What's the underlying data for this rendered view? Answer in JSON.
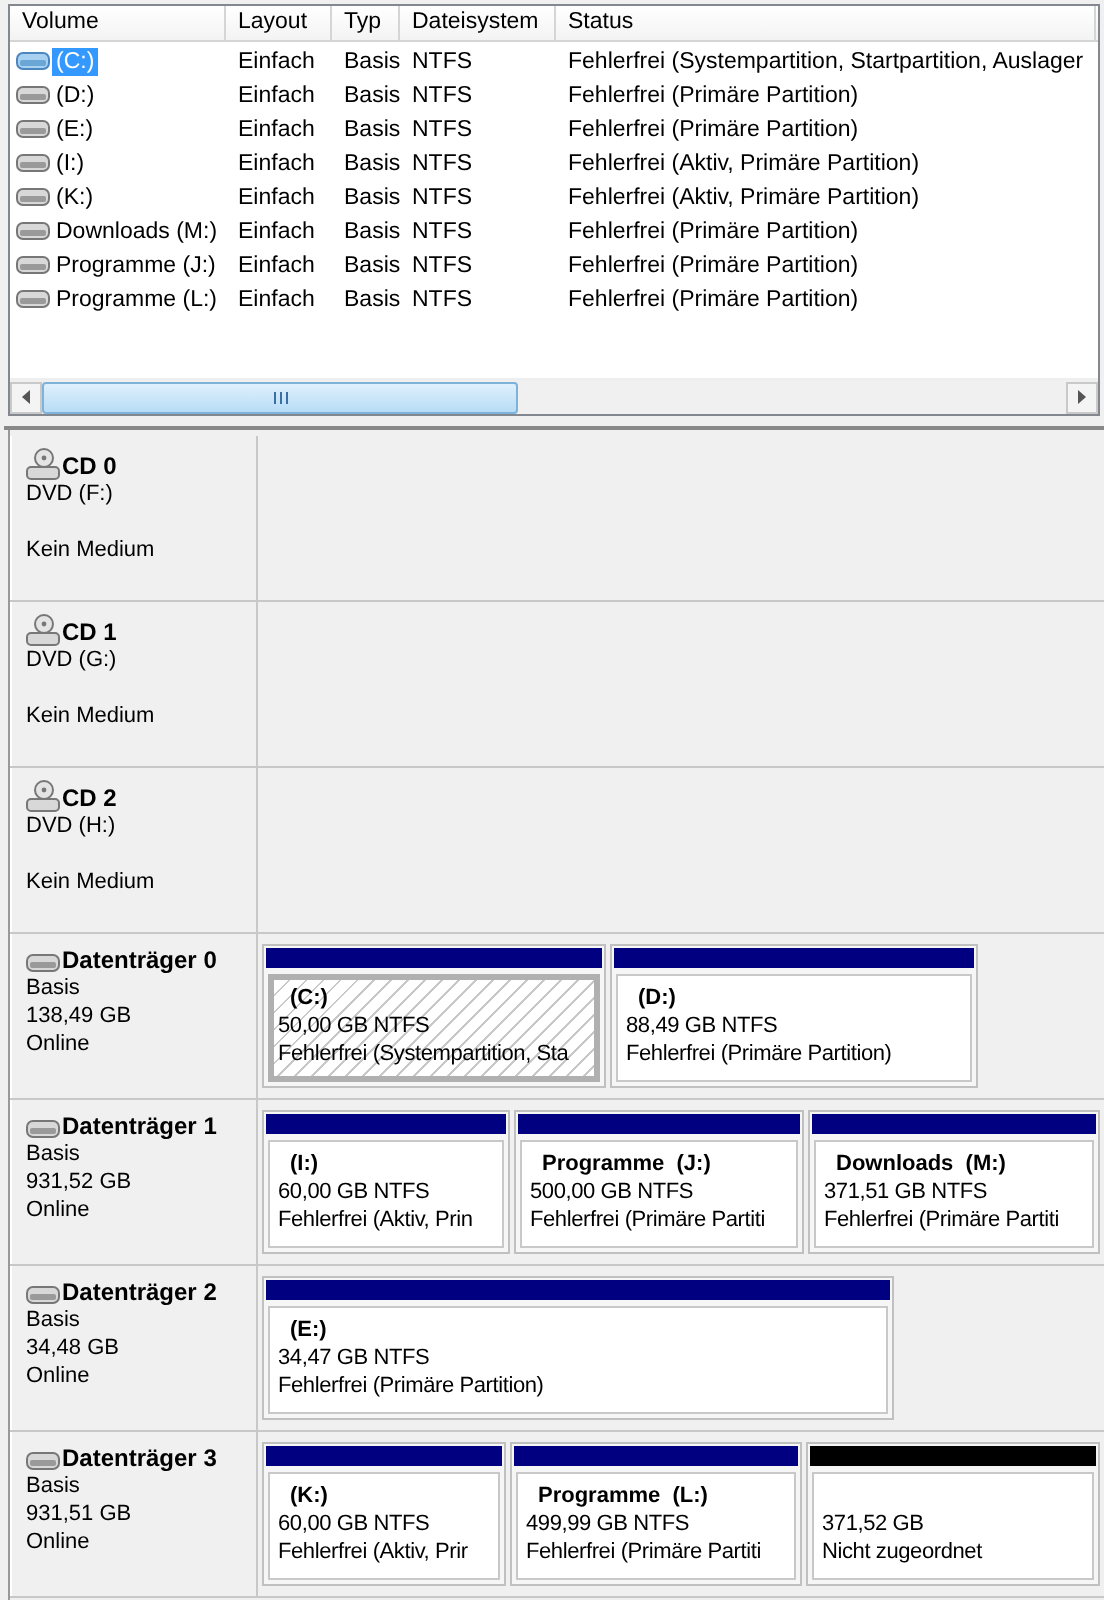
{
  "volume_list": {
    "columns": [
      "Volume",
      "Layout",
      "Typ",
      "Dateisystem",
      "Status"
    ],
    "rows": [
      {
        "volume": "(C:)",
        "layout": "Einfach",
        "type": "Basis",
        "filesystem": "NTFS",
        "status": "Fehlerfrei (Systempartition, Startpartition, Auslager",
        "selected": true
      },
      {
        "volume": "(D:)",
        "layout": "Einfach",
        "type": "Basis",
        "filesystem": "NTFS",
        "status": "Fehlerfrei (Primäre Partition)",
        "selected": false
      },
      {
        "volume": "(E:)",
        "layout": "Einfach",
        "type": "Basis",
        "filesystem": "NTFS",
        "status": "Fehlerfrei (Primäre Partition)",
        "selected": false
      },
      {
        "volume": "(I:)",
        "layout": "Einfach",
        "type": "Basis",
        "filesystem": "NTFS",
        "status": "Fehlerfrei (Aktiv, Primäre Partition)",
        "selected": false
      },
      {
        "volume": "(K:)",
        "layout": "Einfach",
        "type": "Basis",
        "filesystem": "NTFS",
        "status": "Fehlerfrei (Aktiv, Primäre Partition)",
        "selected": false
      },
      {
        "volume": "Downloads (M:)",
        "layout": "Einfach",
        "type": "Basis",
        "filesystem": "NTFS",
        "status": "Fehlerfrei (Primäre Partition)",
        "selected": false
      },
      {
        "volume": "Programme (J:)",
        "layout": "Einfach",
        "type": "Basis",
        "filesystem": "NTFS",
        "status": "Fehlerfrei (Primäre Partition)",
        "selected": false
      },
      {
        "volume": "Programme (L:)",
        "layout": "Einfach",
        "type": "Basis",
        "filesystem": "NTFS",
        "status": "Fehlerfrei (Primäre Partition)",
        "selected": false
      }
    ]
  },
  "disks": [
    {
      "kind": "cd",
      "name": "CD 0",
      "type": "DVD (F:)",
      "status": "Kein Medium"
    },
    {
      "kind": "cd",
      "name": "CD 1",
      "type": "DVD (G:)",
      "status": "Kein Medium"
    },
    {
      "kind": "cd",
      "name": "CD 2",
      "type": "DVD (H:)",
      "status": "Kein Medium"
    },
    {
      "kind": "disk",
      "name": "Datenträger 0",
      "type": "Basis",
      "size": "138,49 GB",
      "status": "Online",
      "partitions": [
        {
          "kind": "primary",
          "label": "(C:)",
          "size": "50,00 GB NTFS",
          "status": "Fehlerfrei (Systempartition, Sta",
          "selected": true
        },
        {
          "kind": "primary",
          "label": "(D:)",
          "size": "88,49 GB NTFS",
          "status": "Fehlerfrei (Primäre Partition)",
          "selected": false
        }
      ]
    },
    {
      "kind": "disk",
      "name": "Datenträger 1",
      "type": "Basis",
      "size": "931,52 GB",
      "status": "Online",
      "partitions": [
        {
          "kind": "primary",
          "label": "(I:)",
          "size": "60,00 GB NTFS",
          "status": "Fehlerfrei (Aktiv, Prin",
          "selected": false
        },
        {
          "kind": "primary",
          "label": "Programme  (J:)",
          "size": "500,00 GB NTFS",
          "status": "Fehlerfrei (Primäre Partiti",
          "selected": false
        },
        {
          "kind": "primary",
          "label": "Downloads  (M:)",
          "size": "371,51 GB NTFS",
          "status": "Fehlerfrei (Primäre Partiti",
          "selected": false
        }
      ]
    },
    {
      "kind": "disk",
      "name": "Datenträger 2",
      "type": "Basis",
      "size": "34,48 GB",
      "status": "Online",
      "partitions": [
        {
          "kind": "primary",
          "label": "(E:)",
          "size": "34,47 GB NTFS",
          "status": "Fehlerfrei (Primäre Partition)",
          "selected": false
        }
      ]
    },
    {
      "kind": "disk",
      "name": "Datenträger 3",
      "type": "Basis",
      "size": "931,51 GB",
      "status": "Online",
      "partitions": [
        {
          "kind": "primary",
          "label": "(K:)",
          "size": "60,00 GB NTFS",
          "status": "Fehlerfrei (Aktiv, Prir",
          "selected": false
        },
        {
          "kind": "primary",
          "label": "Programme  (L:)",
          "size": "499,99 GB NTFS",
          "status": "Fehlerfrei (Primäre Partiti",
          "selected": false
        },
        {
          "kind": "unallocated",
          "size": "371,52 GB",
          "status": "Nicht zugeordnet",
          "selected": false
        }
      ]
    }
  ]
}
